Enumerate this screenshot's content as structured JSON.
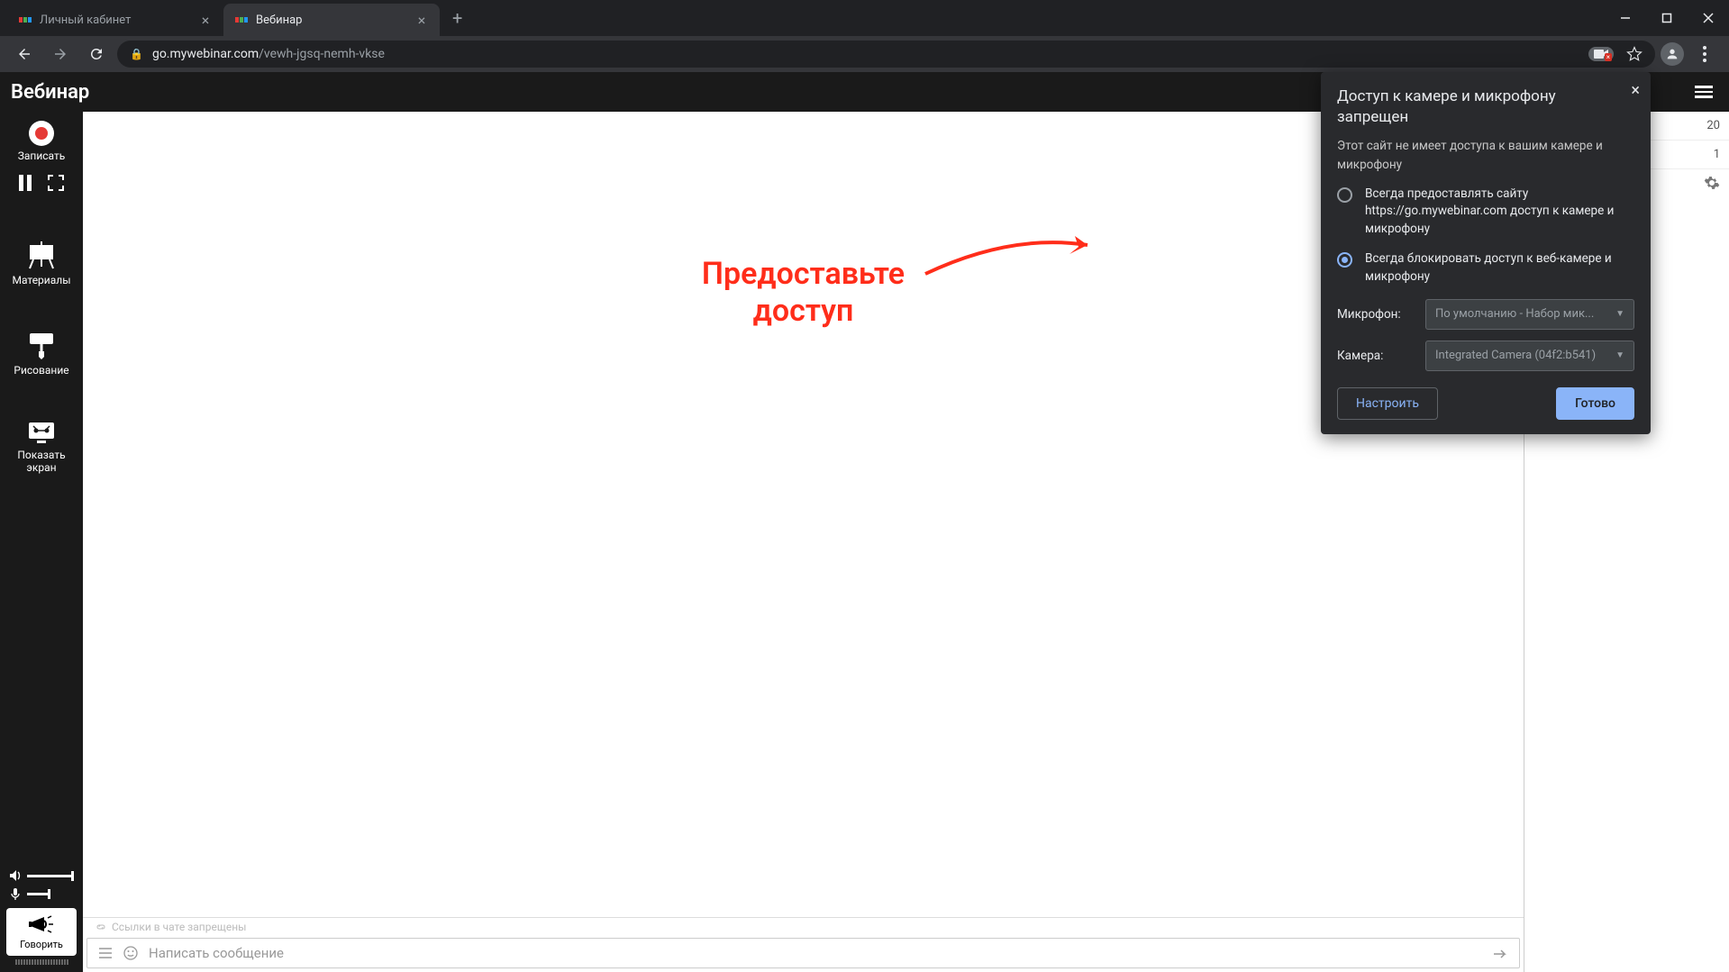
{
  "browser": {
    "tabs": [
      {
        "title": "Личный кабинет",
        "active": false
      },
      {
        "title": "Вебинар",
        "active": true
      }
    ],
    "url_domain": "go.mywebinar.com",
    "url_path": "/vewh-jgsq-nemh-vkse"
  },
  "app": {
    "title": "Вебинар"
  },
  "sidebar": {
    "record": "Записать",
    "materials": "Материалы",
    "drawing": "Рисование",
    "share_screen_line1": "Показать",
    "share_screen_line2": "экран",
    "speak": "Говорить"
  },
  "annotation": {
    "line1": "Предоставьте",
    "line2": "доступ"
  },
  "chat": {
    "links_disabled": "Ссылки в чате запрещены",
    "placeholder": "Написать сообщение"
  },
  "right_rail": {
    "count1": "20",
    "count2": "1"
  },
  "popup": {
    "title": "Доступ к камере и микрофону запрещен",
    "description": "Этот сайт не имеет доступа к вашим камере и микрофону",
    "option_allow": "Всегда предоставлять сайту https://go.mywebinar.com доступ к камере и микрофону",
    "option_block": "Всегда блокировать доступ к веб-камере и микрофону",
    "mic_label": "Микрофон:",
    "mic_value": "По умолчанию - Набор мик...",
    "cam_label": "Камера:",
    "cam_value": "Integrated Camera (04f2:b541)",
    "configure": "Настроить",
    "done": "Готово"
  }
}
